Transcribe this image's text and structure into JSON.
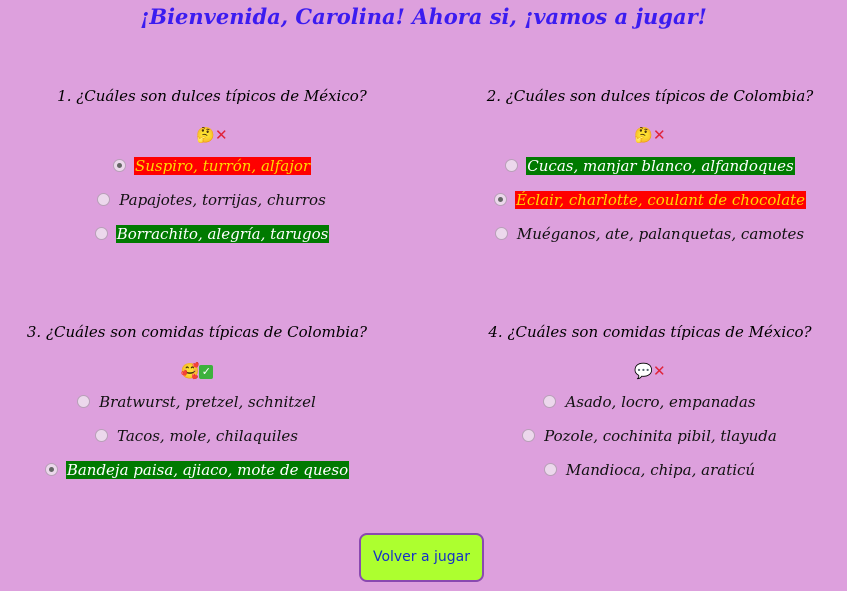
{
  "header": {
    "title": "¡Bienvenida, Carolina! Ahora si, ¡vamos a jugar!"
  },
  "questions": [
    {
      "text": "1. ¿Cuáles son dulces típicos de México?",
      "feedback_emoji": "🤔",
      "feedback_mark": "✕",
      "feedback_result": "wrong",
      "options": [
        {
          "label": "Suspiro, turrón, alfajor",
          "selected": true,
          "state": "wrong"
        },
        {
          "label": "Papajotes, torrijas, churros",
          "selected": false,
          "state": "none"
        },
        {
          "label": "Borrachito, alegría, tarugos",
          "selected": false,
          "state": "correct"
        }
      ]
    },
    {
      "text": "2. ¿Cuáles son dulces típicos de Colombia?",
      "feedback_emoji": "🤔",
      "feedback_mark": "✕",
      "feedback_result": "wrong",
      "options": [
        {
          "label": "Cucas, manjar blanco, alfandoques",
          "selected": false,
          "state": "correct"
        },
        {
          "label": "Éclair, charlotte, coulant de chocolate",
          "selected": true,
          "state": "wrong"
        },
        {
          "label": "Muéganos, ate, palanquetas, camotes",
          "selected": false,
          "state": "none"
        }
      ]
    },
    {
      "text": "3. ¿Cuáles son comidas típicas de Colombia?",
      "feedback_emoji": "🥰",
      "feedback_mark": "✓",
      "feedback_result": "right",
      "options": [
        {
          "label": "Bratwurst, pretzel, schnitzel",
          "selected": false,
          "state": "none"
        },
        {
          "label": "Tacos, mole, chilaquiles",
          "selected": false,
          "state": "none"
        },
        {
          "label": "Bandeja paisa, ajiaco, mote de queso",
          "selected": true,
          "state": "correct"
        }
      ]
    },
    {
      "text": "4. ¿Cuáles son comidas típicas de México?",
      "feedback_emoji": "💬",
      "feedback_mark": "✕",
      "feedback_result": "wrong",
      "options": [
        {
          "label": "Asado, locro, empanadas",
          "selected": false,
          "state": "none"
        },
        {
          "label": "Pozole, cochinita pibil, tlayuda",
          "selected": false,
          "state": "none"
        },
        {
          "label": "Mandioca, chipa, araticú",
          "selected": false,
          "state": "none"
        }
      ]
    }
  ],
  "footer": {
    "replay_label": "Volver a jugar"
  },
  "colors": {
    "background": "#dda0dd",
    "title": "#3b1cf0",
    "correct_bg": "#007a00",
    "wrong_bg": "#ff0000",
    "wrong_text": "#ffd700",
    "button_bg": "#adff2f"
  }
}
